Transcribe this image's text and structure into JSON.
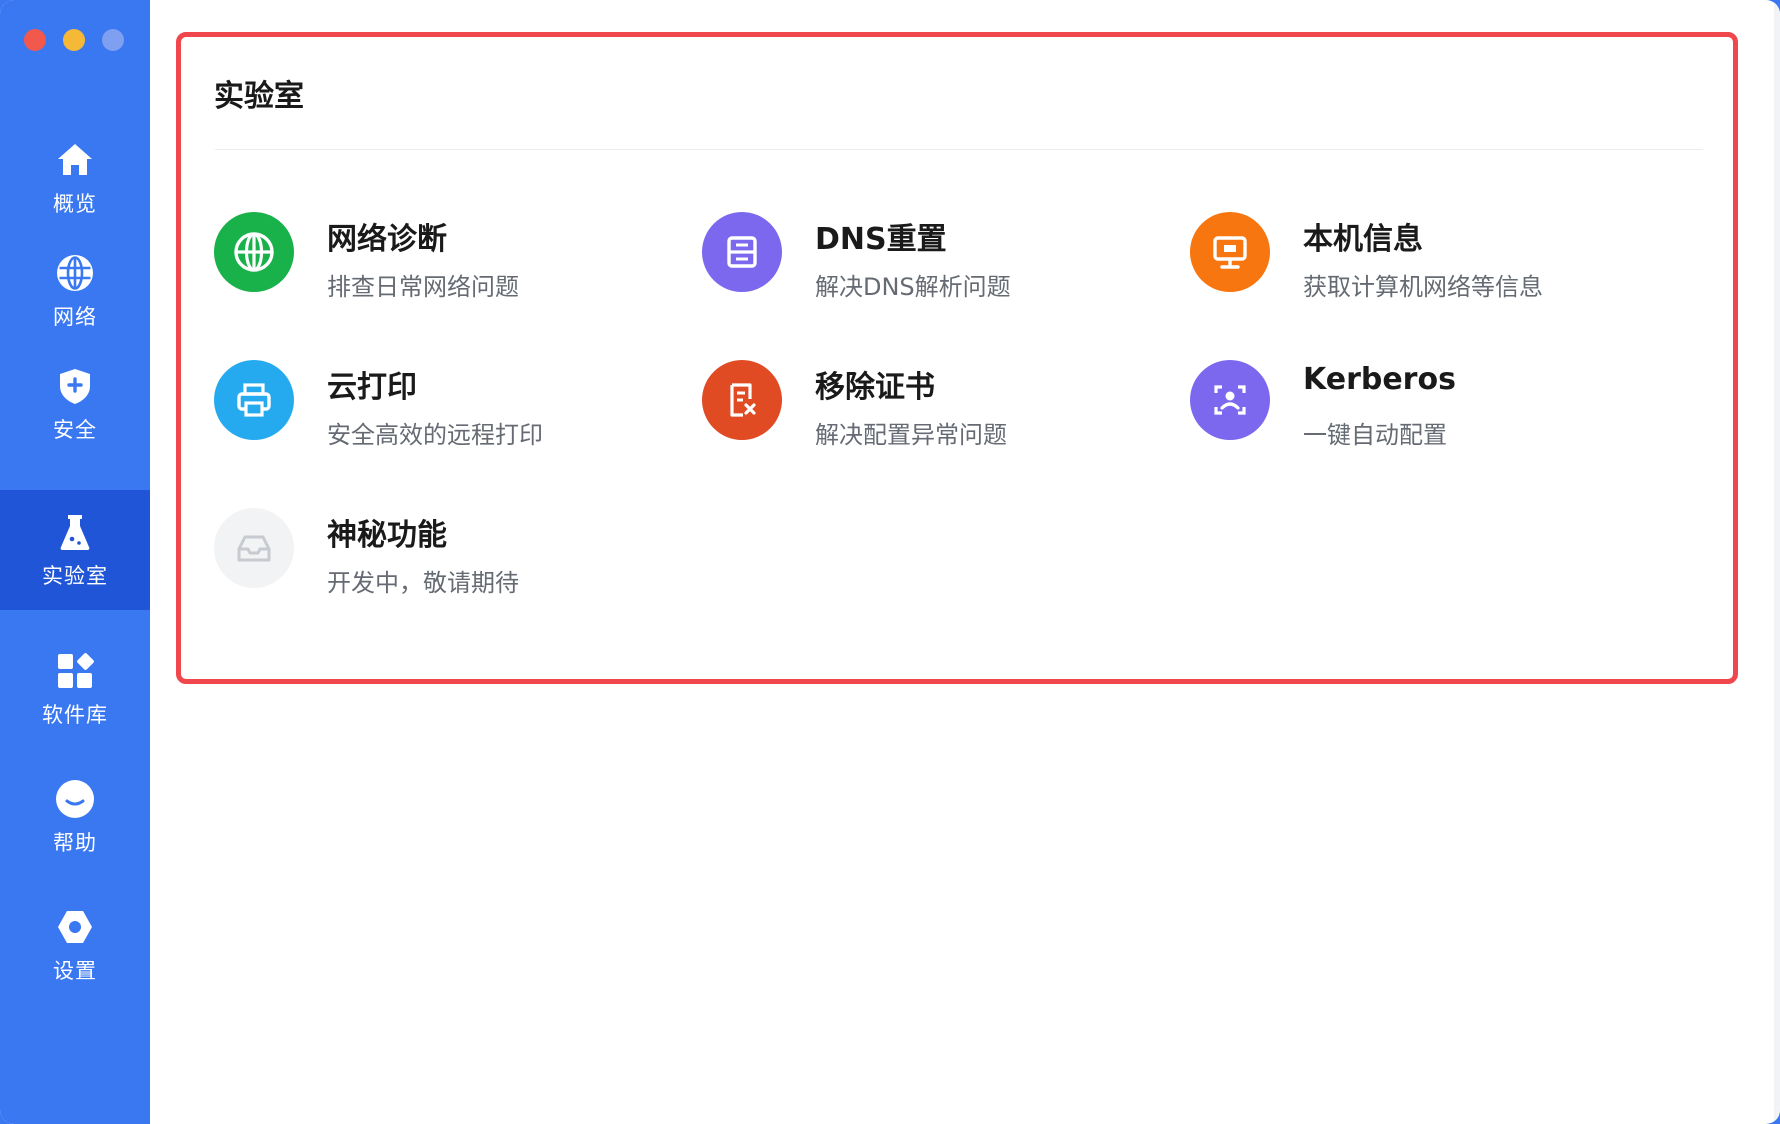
{
  "window": {
    "traffic_lights": [
      "close",
      "minimize",
      "maximize"
    ]
  },
  "sidebar": {
    "items": [
      {
        "label": "概览",
        "icon": "home-icon"
      },
      {
        "label": "网络",
        "icon": "globe-icon"
      },
      {
        "label": "安全",
        "icon": "shield-icon"
      },
      {
        "label": "实验室",
        "icon": "flask-icon",
        "active": true
      },
      {
        "label": "软件库",
        "icon": "apps-icon"
      },
      {
        "label": "帮助",
        "icon": "help-icon"
      },
      {
        "label": "设置",
        "icon": "gear-icon"
      }
    ]
  },
  "main": {
    "title": "实验室",
    "tools": [
      {
        "title": "网络诊断",
        "desc": "排查日常网络问题",
        "icon": "globe-icon",
        "color": "#19b14a"
      },
      {
        "title": "DNS重置",
        "desc": "解决DNS解析问题",
        "icon": "server-icon",
        "color": "#7b68ee"
      },
      {
        "title": "本机信息",
        "desc": "获取计算机网络等信息",
        "icon": "monitor-icon",
        "color": "#f7760f"
      },
      {
        "title": "云打印",
        "desc": "安全高效的远程打印",
        "icon": "printer-icon",
        "color": "#25aaf0"
      },
      {
        "title": "移除证书",
        "desc": "解决配置异常问题",
        "icon": "certificate-remove-icon",
        "color": "#e04b24"
      },
      {
        "title": "Kerberos",
        "desc": "一键自动配置",
        "icon": "face-scan-icon",
        "color": "#7b68ee"
      },
      {
        "title": "神秘功能",
        "desc": "开发中，敬请期待",
        "icon": "inbox-icon",
        "color": "#f2f3f5"
      }
    ]
  },
  "colors": {
    "sidebar": "#3a78f2",
    "sidebar_active": "#1f55d6",
    "highlight_border": "#f0474d"
  }
}
